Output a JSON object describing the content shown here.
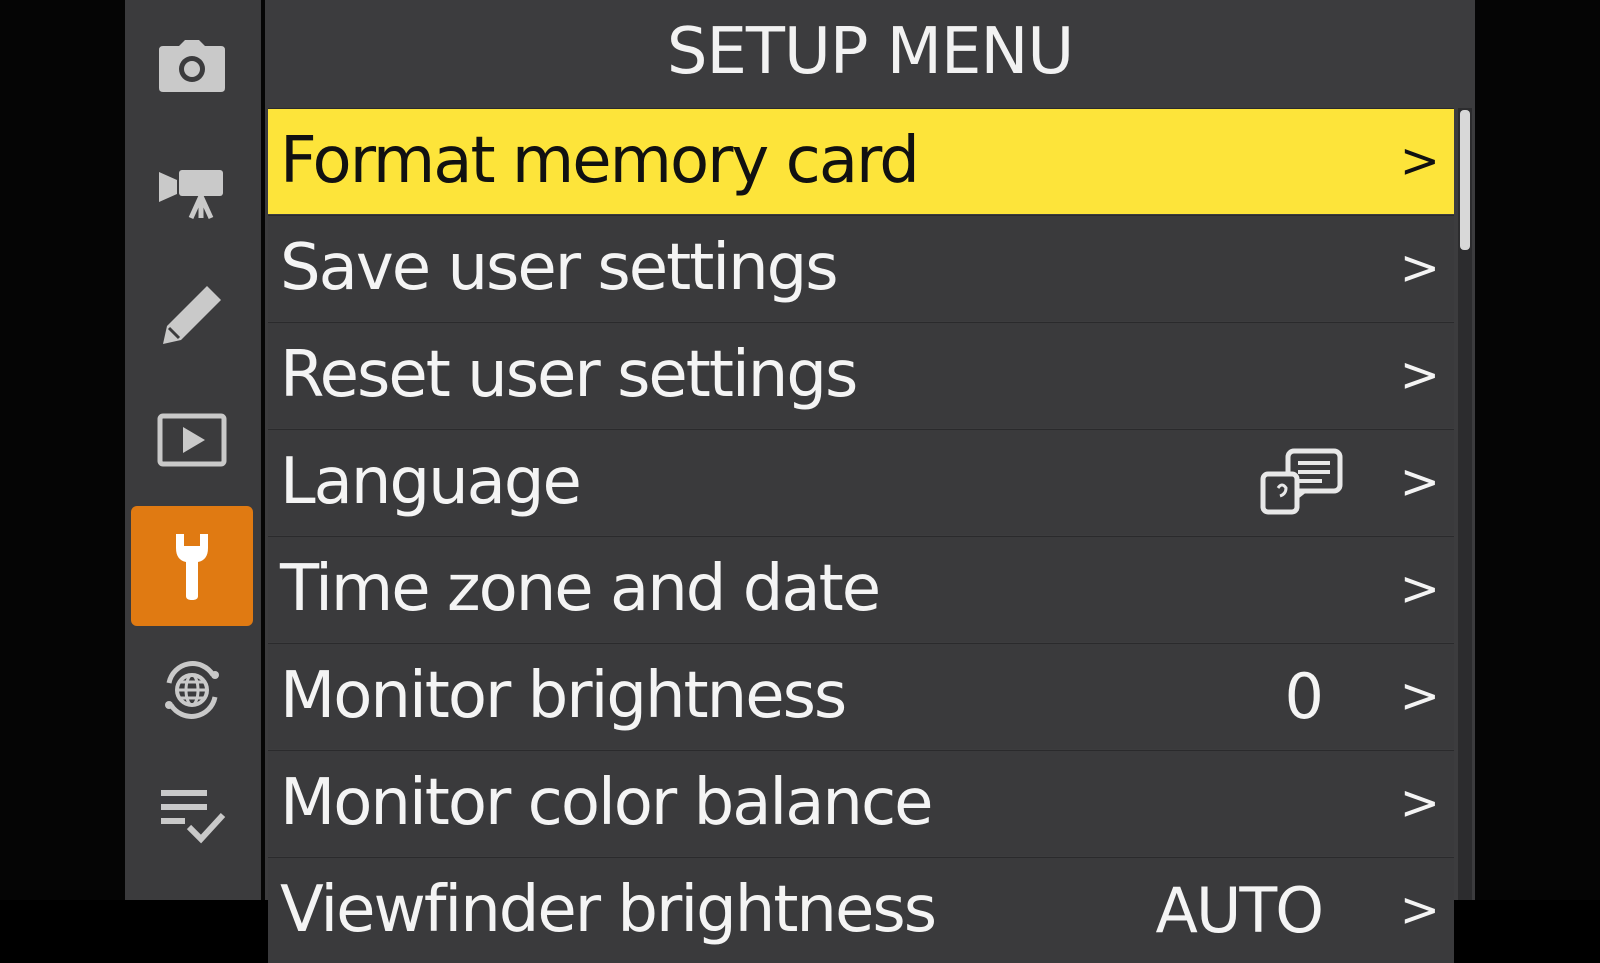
{
  "menu": {
    "title": "SETUP MENU",
    "items": [
      {
        "label": "Format memory card",
        "value": "",
        "selected": true
      },
      {
        "label": "Save user settings",
        "value": ""
      },
      {
        "label": "Reset user settings",
        "value": ""
      },
      {
        "label": "Language",
        "value": "",
        "icon": "language-icon"
      },
      {
        "label": "Time zone and date",
        "value": ""
      },
      {
        "label": "Monitor brightness",
        "value": "0"
      },
      {
        "label": "Monitor color balance",
        "value": ""
      },
      {
        "label": "Viewfinder brightness",
        "value": "AUTO"
      }
    ],
    "chevron": ">"
  },
  "sidebar": {
    "items": [
      {
        "icon": "camera-icon"
      },
      {
        "icon": "movie-camera-icon"
      },
      {
        "icon": "pencil-icon"
      },
      {
        "icon": "playback-icon"
      },
      {
        "icon": "wrench-icon",
        "active": true
      },
      {
        "icon": "network-globe-icon"
      },
      {
        "icon": "my-menu-icon"
      }
    ]
  },
  "colors": {
    "selected_bg": "#fde43a",
    "active_tab": "#e07a12",
    "panel": "#3c3c3e"
  }
}
